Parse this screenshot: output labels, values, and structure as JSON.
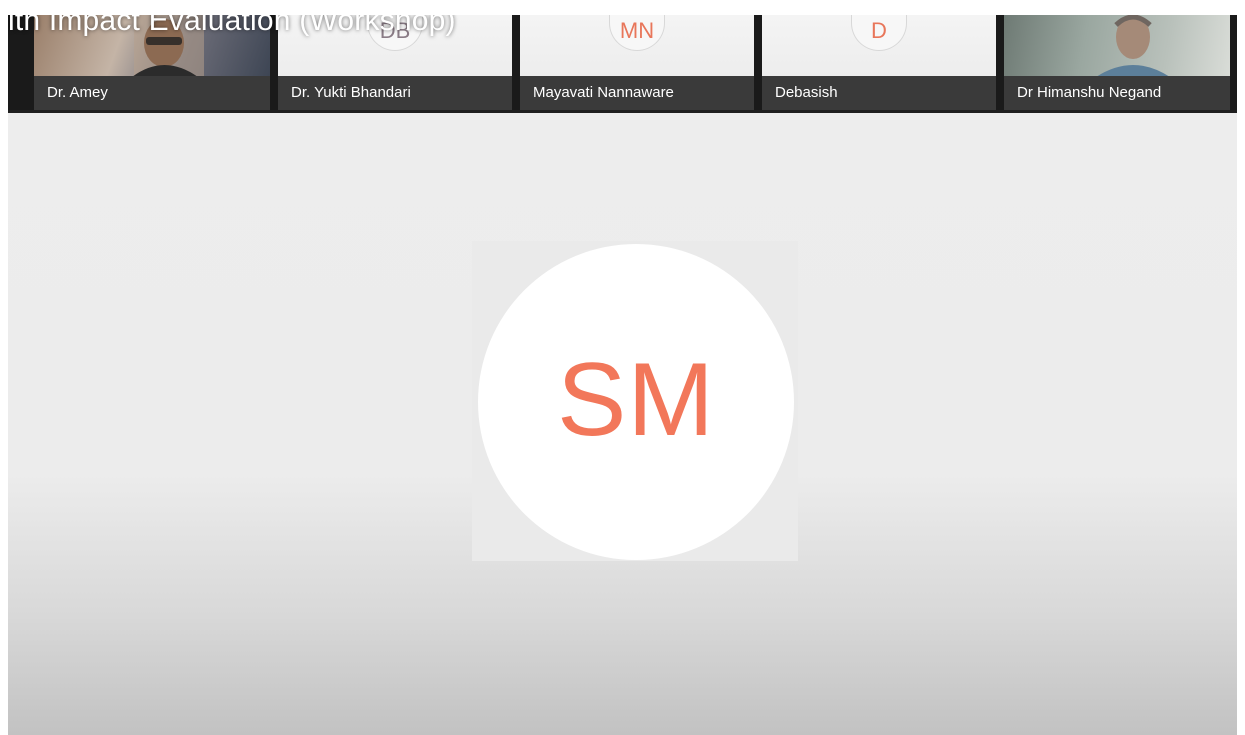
{
  "meeting": {
    "title_overlay": "lth Impact Evaluation (Workshop)"
  },
  "filmstrip": {
    "participants": [
      {
        "name": "Dr. Amey",
        "type": "video",
        "initials": ""
      },
      {
        "name": "Dr. Yukti Bhandari",
        "type": "avatar",
        "initials": "DB",
        "initials_color": "#8a7c86"
      },
      {
        "name": "Mayavati Nannaware",
        "type": "avatar",
        "initials": "MN",
        "initials_color": "#e8765a"
      },
      {
        "name": "Debasish",
        "type": "avatar",
        "initials": "D",
        "initials_color": "#e8765a"
      },
      {
        "name": "Dr Himanshu Negand",
        "type": "video",
        "initials": ""
      }
    ]
  },
  "active_speaker": {
    "initials": "SM",
    "initials_color": "#f2775a"
  }
}
